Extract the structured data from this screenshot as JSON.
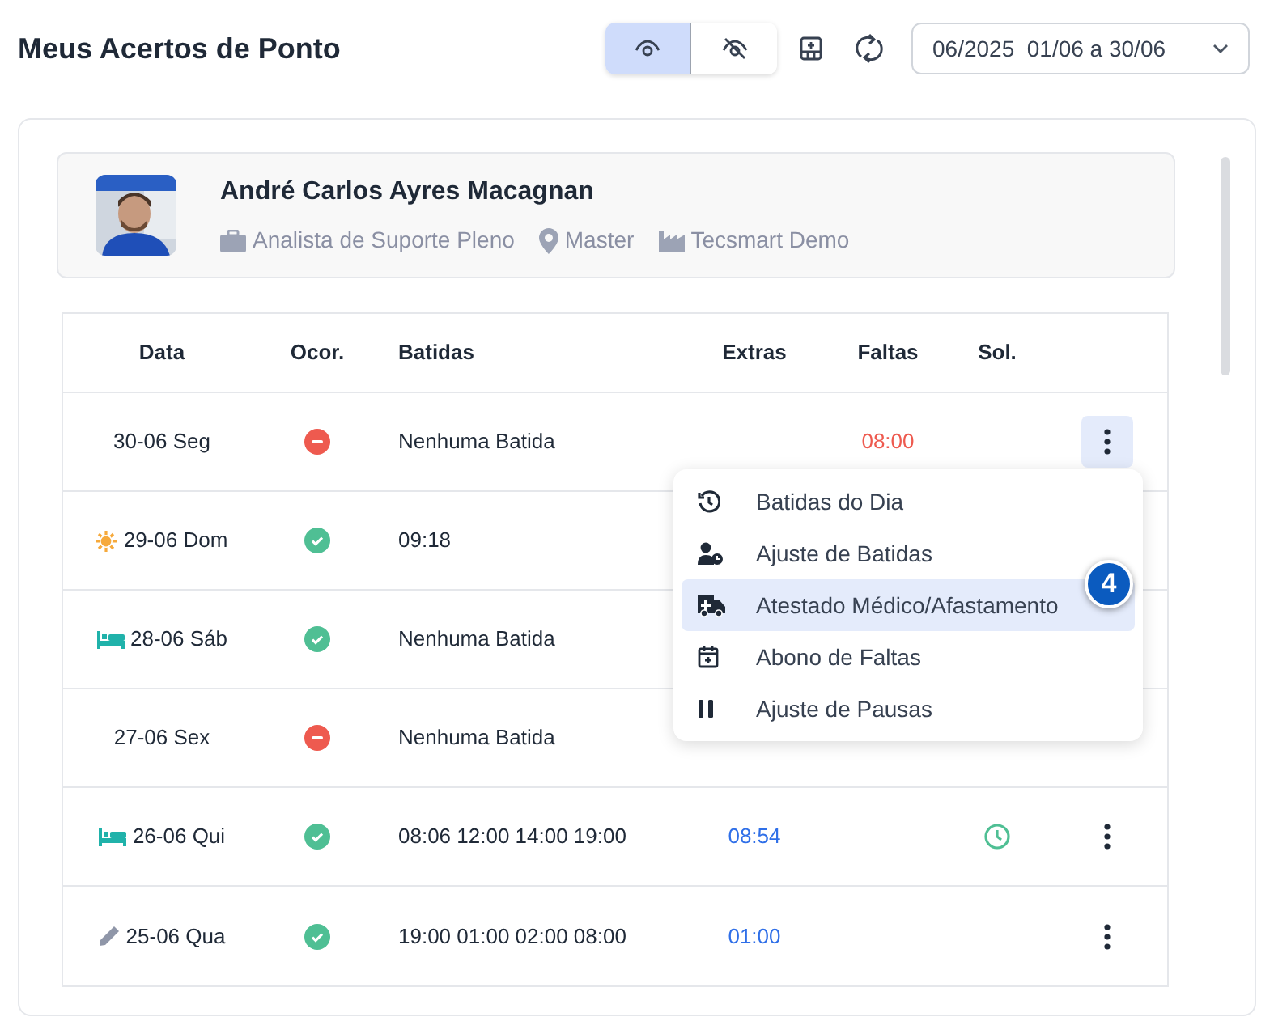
{
  "title": "Meus Acertos de Ponto",
  "toolbar": {
    "view_toggle": [
      {
        "kind": "show",
        "selected": true
      },
      {
        "kind": "hide",
        "selected": false
      }
    ],
    "period": "06/2025  01/06 a 30/06"
  },
  "profile": {
    "name": "André Carlos Ayres Macagnan",
    "details": [
      {
        "kind": "role",
        "text": "Analista de Suporte Pleno"
      },
      {
        "kind": "location",
        "text": "Master"
      },
      {
        "kind": "company",
        "text": "Tecsmart Demo"
      }
    ]
  },
  "table": {
    "columns": [
      "Data",
      "Ocor.",
      "Batidas",
      "Extras",
      "Faltas",
      "Sol."
    ],
    "rows": [
      {
        "kind": "plain",
        "date": "30-06 Seg",
        "absent": true,
        "punches": "Nenhuma Batida",
        "faltas": "08:00",
        "menu_open": true
      },
      {
        "kind": "sun",
        "date": "29-06 Dom",
        "absent": false,
        "punches": "09:18"
      },
      {
        "kind": "bed",
        "date": "28-06 Sáb",
        "absent": false,
        "punches": "Nenhuma Batida"
      },
      {
        "kind": "plain",
        "date": "27-06 Sex",
        "absent": true,
        "punches": "Nenhuma Batida"
      },
      {
        "kind": "bed",
        "date": "26-06 Qui",
        "absent": false,
        "punches": "08:06 12:00 14:00 19:00",
        "extras": "08:54",
        "requested": true,
        "menu_open": false
      },
      {
        "kind": "pencil",
        "date": "25-06 Qua",
        "absent": false,
        "punches": "19:00 01:00 02:00 08:00",
        "extras": "01:00",
        "menu_open": false
      }
    ]
  },
  "menu": {
    "items": [
      {
        "kind": "history",
        "label": "Batidas do Dia",
        "selected": false
      },
      {
        "kind": "user-clock",
        "label": "Ajuste de Batidas",
        "selected": false
      },
      {
        "kind": "ambulance",
        "label": "Atestado Médico/Afastamento",
        "selected": true,
        "badge": "4"
      },
      {
        "kind": "calendar",
        "label": "Abono de Faltas",
        "selected": false
      },
      {
        "kind": "pause",
        "label": "Ajuste de Pausas",
        "selected": false
      }
    ]
  }
}
